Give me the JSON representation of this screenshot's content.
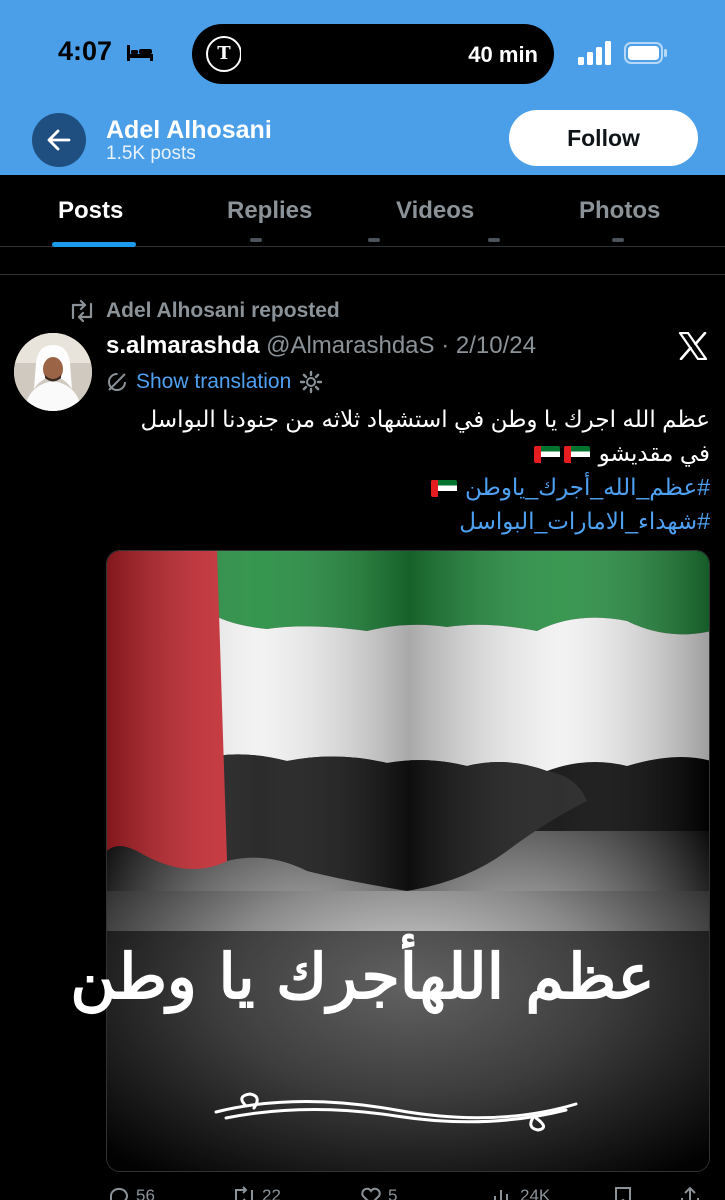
{
  "status": {
    "time": "4:07",
    "island_text": "40 min",
    "icons": [
      "bed-icon",
      "tesla-icon",
      "signal-icon",
      "battery-icon"
    ]
  },
  "header": {
    "profile_name": "Adel Alhosani",
    "post_count": "1.5K posts",
    "follow_label": "Follow"
  },
  "tabs": [
    {
      "label": "Posts",
      "active": true
    },
    {
      "label": "Replies",
      "active": false
    },
    {
      "label": "Videos",
      "active": false
    },
    {
      "label": "Photos",
      "active": false
    }
  ],
  "post": {
    "repost_label": "Adel Alhosani reposted",
    "author_name": "s.almarashda",
    "author_handle": "@AlmarashdaS",
    "date": "· 2/10/24",
    "translate_label": "Show translation",
    "text_line1": "عظم الله اجرك يا وطن في استشهاد ثلاثه من جنودنا البواسل",
    "text_line2": "في مقديشو",
    "hashtag1": "#عظم_الله_أجرك_ياوطن",
    "hashtag2": "#شهداء_الامارات_البواسل",
    "image_caption": "عظم اللهأجرك يا وطن"
  },
  "actions": {
    "replies": "56",
    "reposts": "22",
    "likes": "5",
    "views": "24K"
  },
  "colors": {
    "header_bg": "#4a9fe8",
    "accent": "#1d9bf0",
    "link": "#4ea1f0",
    "muted": "#8b9298"
  }
}
